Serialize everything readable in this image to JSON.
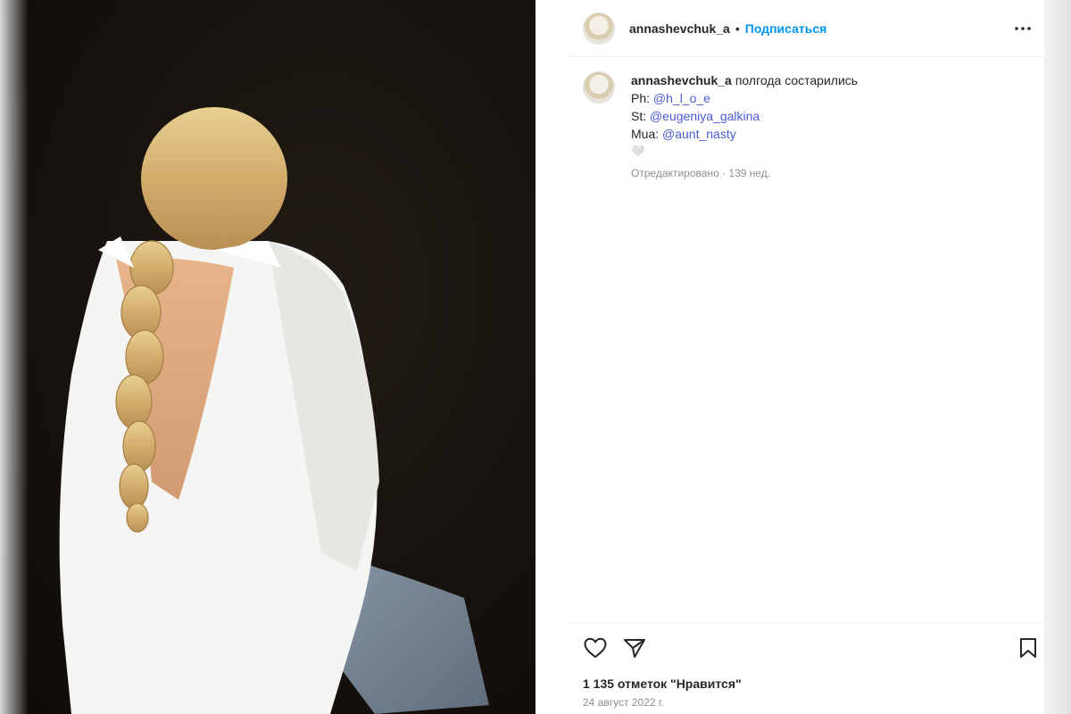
{
  "post": {
    "image_alt": "Фото: женщина в белой рубашке с открытой спиной и длинной светлой косой",
    "header": {
      "username": "annashevchuk_a",
      "separator": "•",
      "follow_label": "Подписаться",
      "more_icon": "more-horizontal-icon"
    },
    "caption": {
      "username": "annashevchuk_a",
      "text": "полгода состарились",
      "lines": [
        {
          "prefix": "Ph:",
          "mention": "@h_l_o_e"
        },
        {
          "prefix": "St:",
          "mention": "@eugeniya_galkina"
        },
        {
          "prefix": "Mua:",
          "mention": "@aunt_nasty"
        }
      ],
      "emoji": "🤍",
      "edited": "Отредактировано · 139 нед."
    },
    "actions": {
      "like_icon": "heart-icon",
      "share_icon": "paper-plane-icon",
      "save_icon": "bookmark-icon"
    },
    "likes": "1 135 отметок \"Нравится\"",
    "date": "24 август 2022 г."
  }
}
